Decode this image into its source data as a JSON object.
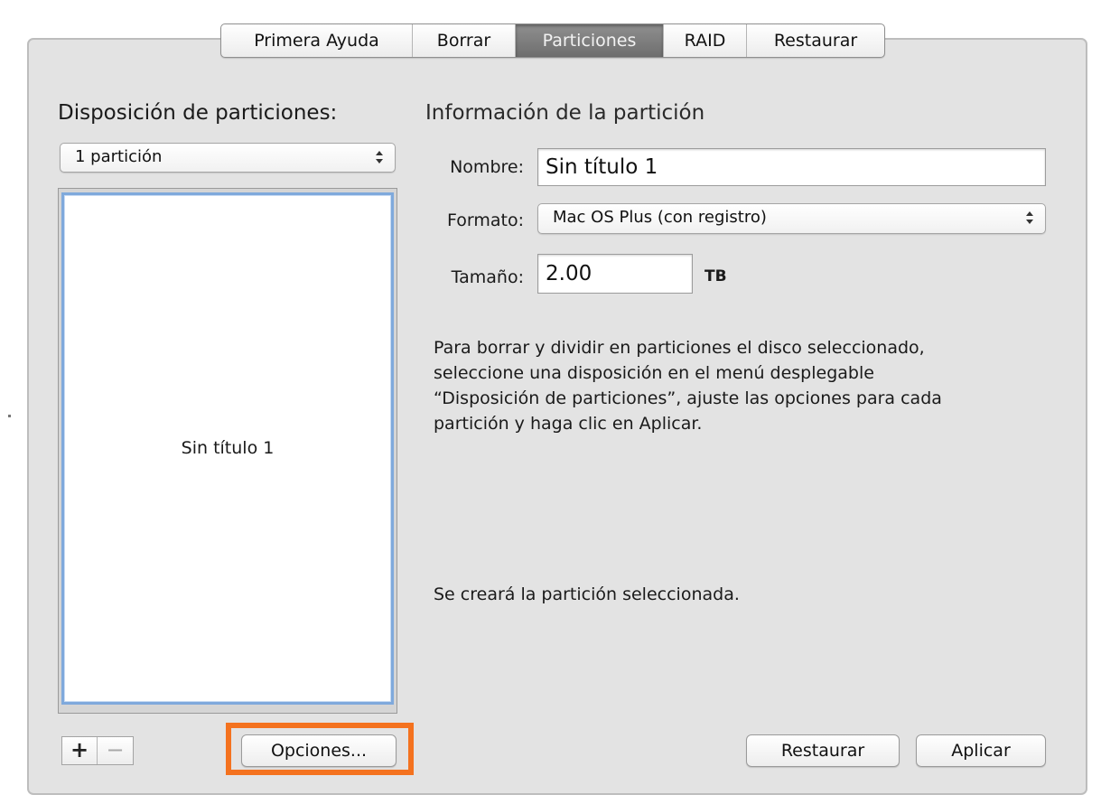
{
  "tabs": [
    {
      "label": "Primera Ayuda",
      "active": false
    },
    {
      "label": "Borrar",
      "active": false
    },
    {
      "label": "Particiones",
      "active": true
    },
    {
      "label": "RAID",
      "active": false
    },
    {
      "label": "Restaurar",
      "active": false
    }
  ],
  "layout": {
    "title": "Disposición de particiones:",
    "selected_scheme": "1 partición",
    "partition_label": "Sin título 1",
    "add_label": "+",
    "remove_label": "−",
    "options_button": "Opciones..."
  },
  "info": {
    "title": "Información de la partición",
    "name_label": "Nombre:",
    "name_value": "Sin título 1",
    "format_label": "Formato:",
    "format_value": "Mac OS Plus (con registro)",
    "size_label": "Tamaño:",
    "size_value": "2.00",
    "size_unit": "TB",
    "description": "Para borrar y dividir en particiones el disco seleccionado,\nseleccione una disposición en el menú desplegable\n“Disposición de particiones”, ajuste las opciones para cada\npartición y haga clic en Aplicar.",
    "status": "Se creará la partición seleccionada."
  },
  "actions": {
    "restore_button": "Restaurar",
    "apply_button": "Aplicar"
  },
  "colors": {
    "highlight": "#f4721f",
    "selection_border": "#7fa9dc",
    "panel_background": "#e3e3e3"
  }
}
